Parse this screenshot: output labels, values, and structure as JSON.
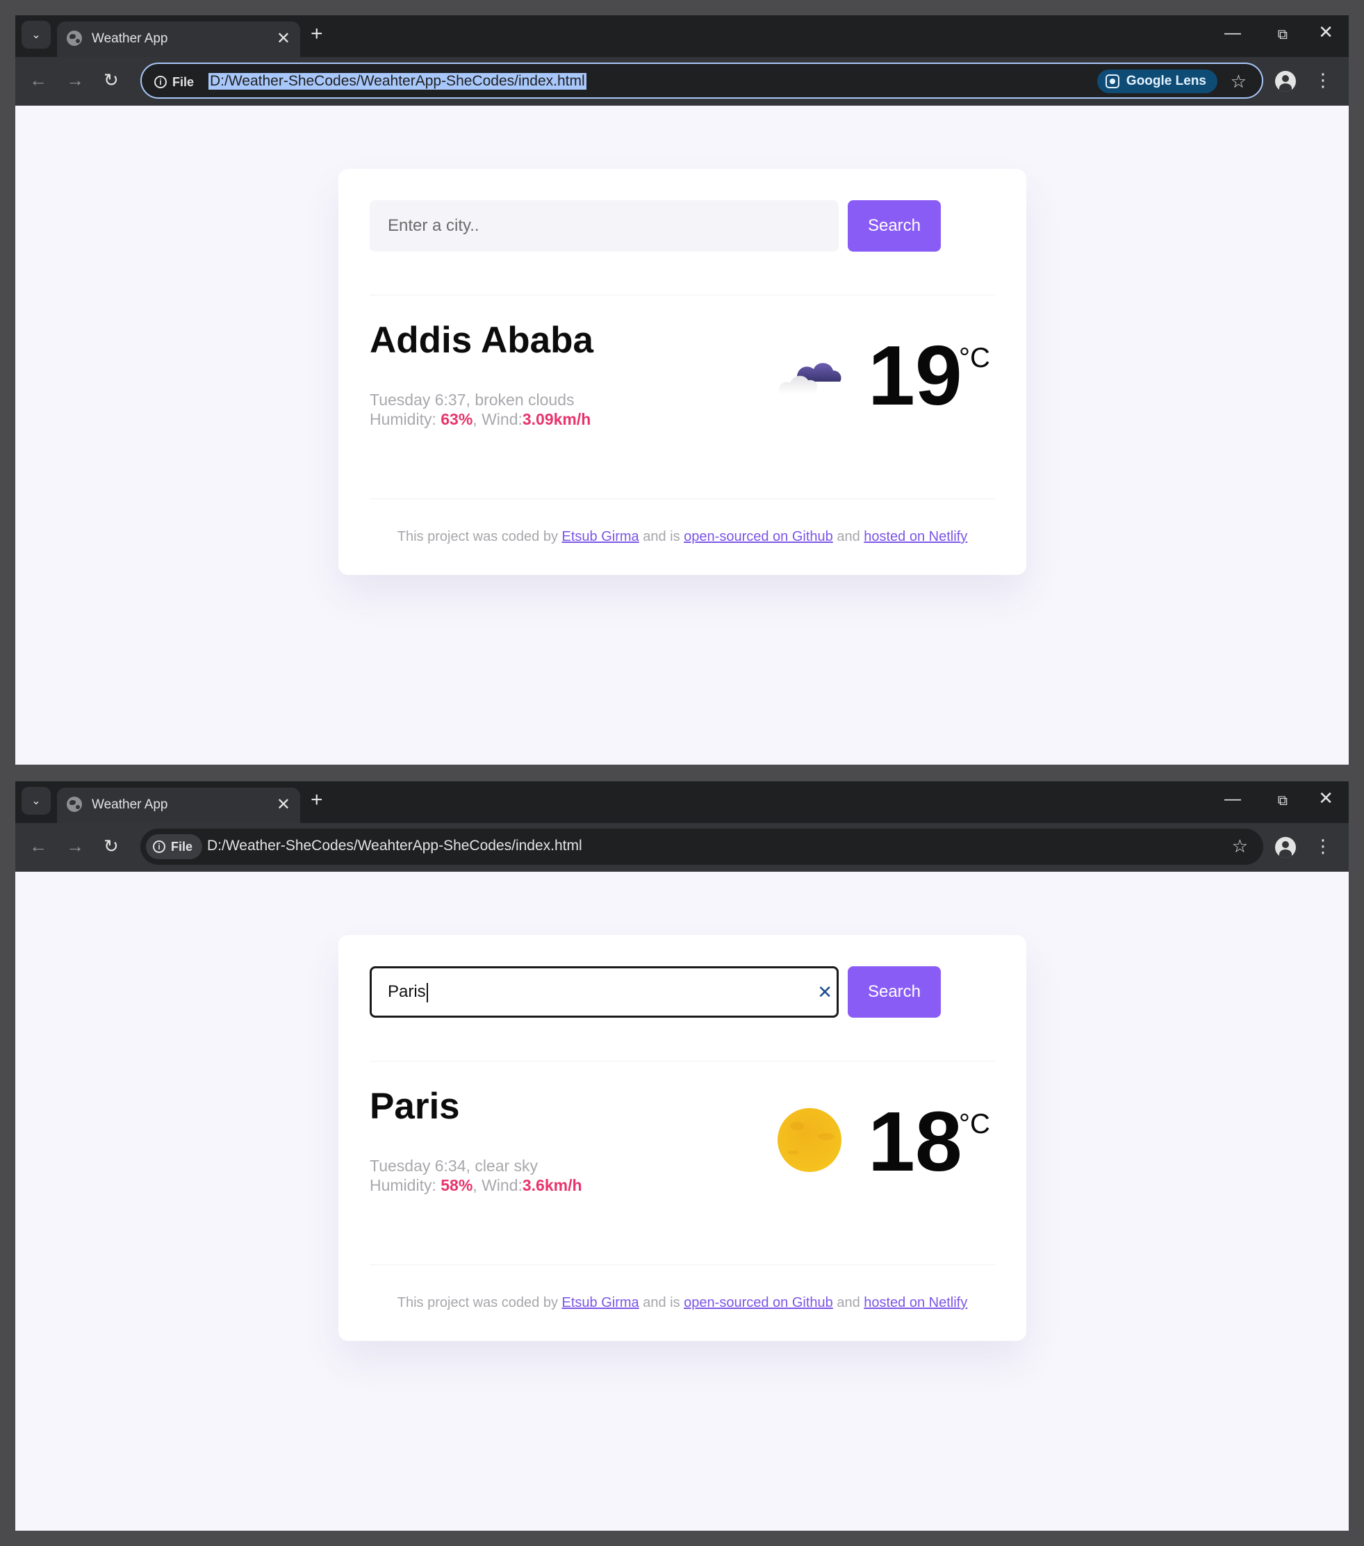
{
  "browser": {
    "tab_title": "Weather App",
    "file_label": "File",
    "url": "D:/Weather-SheCodes/WeahterApp-SheCodes/index.html",
    "lens_label": "Google Lens",
    "new_tab_symbol": "+",
    "close_symbol": "✕"
  },
  "footer": {
    "text_1": "This project was coded by ",
    "author": "Etsub Girma",
    "text_2": " and is ",
    "github": "open-sourced on Github",
    "text_3": " and ",
    "netlify": "hosted on Netlify"
  },
  "screen1": {
    "search": {
      "placeholder": "Enter a city..",
      "button": "Search"
    },
    "weather": {
      "city": "Addis Ababa",
      "day_time": "Tuesday 6:37",
      "description": "broken clouds",
      "humidity_label": "Humidity: ",
      "humidity": "63%",
      "wind_label": "Wind:",
      "wind": "3.09km/h",
      "temperature": "19",
      "unit": "°C",
      "icon": "broken-clouds-icon"
    }
  },
  "screen2": {
    "search": {
      "value": "Paris",
      "button": "Search"
    },
    "weather": {
      "city": "Paris",
      "day_time": "Tuesday 6:34",
      "description": "clear sky",
      "humidity_label": "Humidity: ",
      "humidity": "58%",
      "wind_label": "Wind:",
      "wind": "3.6km/h",
      "temperature": "18",
      "unit": "°C",
      "icon": "clear-sky-sun-icon"
    }
  },
  "colors": {
    "accent": "#8a5cf6",
    "highlight": "#e8336c",
    "link": "#7c55e6",
    "page_bg": "#f7f6fc"
  }
}
